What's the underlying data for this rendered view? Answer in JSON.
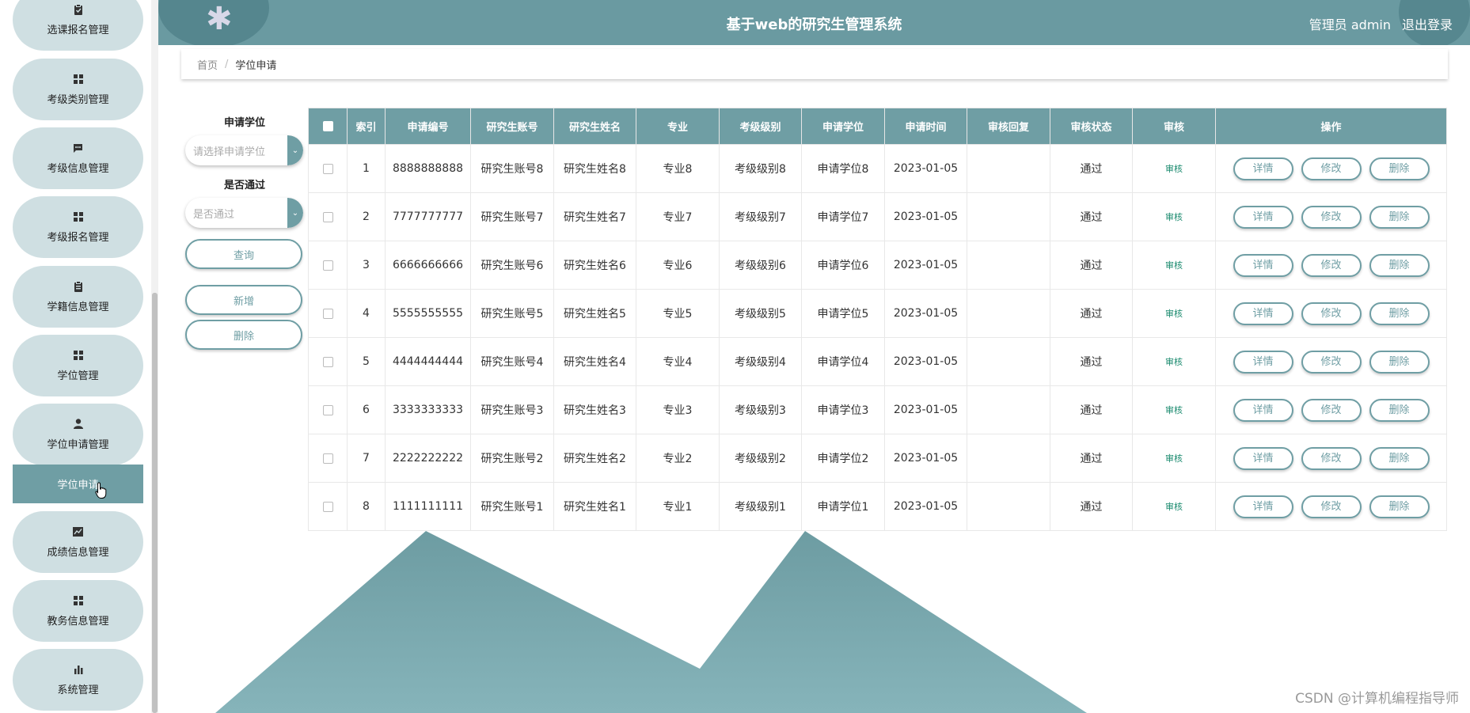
{
  "header": {
    "title": "基于web的研究生管理系统",
    "user_text": "管理员 admin",
    "logout_label": "退出登录"
  },
  "sidebar": {
    "items": [
      {
        "label": "选课报名管理",
        "icon": "clipboard-icon"
      },
      {
        "label": "考级类别管理",
        "icon": "grid-icon"
      },
      {
        "label": "考级信息管理",
        "icon": "chat-icon"
      },
      {
        "label": "考级报名管理",
        "icon": "grid-icon"
      },
      {
        "label": "学籍信息管理",
        "icon": "clipboard-icon"
      },
      {
        "label": "学位管理",
        "icon": "grid-icon"
      },
      {
        "label": "学位申请管理",
        "icon": "person-icon"
      },
      {
        "label": "成绩信息管理",
        "icon": "line-chart-icon"
      },
      {
        "label": "教务信息管理",
        "icon": "grid-icon"
      },
      {
        "label": "系统管理",
        "icon": "bar-chart-icon"
      }
    ],
    "active_sub": "学位申请"
  },
  "breadcrumb": {
    "home": "首页",
    "separator": "/",
    "current": "学位申请"
  },
  "search": {
    "degree_label": "申请学位",
    "degree_placeholder": "请选择申请学位",
    "passed_label": "是否通过",
    "passed_placeholder": "是否通过",
    "query_label": "查询",
    "add_label": "新增",
    "delete_label": "删除"
  },
  "table": {
    "columns": [
      "索引",
      "申请编号",
      "研究生账号",
      "研究生姓名",
      "专业",
      "考级级别",
      "申请学位",
      "申请时间",
      "审核回复",
      "审核状态",
      "审核",
      "操作"
    ],
    "audit_label": "审核",
    "op_labels": {
      "detail": "详情",
      "edit": "修改",
      "delete": "删除"
    },
    "rows": [
      {
        "index": "1",
        "app_no": "8888888888",
        "account": "研究生账号8",
        "name": "研究生姓名8",
        "major": "专业8",
        "level": "考级级别8",
        "degree": "申请学位8",
        "date": "2023-01-05",
        "reply": "",
        "status": "通过"
      },
      {
        "index": "2",
        "app_no": "7777777777",
        "account": "研究生账号7",
        "name": "研究生姓名7",
        "major": "专业7",
        "level": "考级级别7",
        "degree": "申请学位7",
        "date": "2023-01-05",
        "reply": "",
        "status": "通过"
      },
      {
        "index": "3",
        "app_no": "6666666666",
        "account": "研究生账号6",
        "name": "研究生姓名6",
        "major": "专业6",
        "level": "考级级别6",
        "degree": "申请学位6",
        "date": "2023-01-05",
        "reply": "",
        "status": "通过"
      },
      {
        "index": "4",
        "app_no": "5555555555",
        "account": "研究生账号5",
        "name": "研究生姓名5",
        "major": "专业5",
        "level": "考级级别5",
        "degree": "申请学位5",
        "date": "2023-01-05",
        "reply": "",
        "status": "通过"
      },
      {
        "index": "5",
        "app_no": "4444444444",
        "account": "研究生账号4",
        "name": "研究生姓名4",
        "major": "专业4",
        "level": "考级级别4",
        "degree": "申请学位4",
        "date": "2023-01-05",
        "reply": "",
        "status": "通过"
      },
      {
        "index": "6",
        "app_no": "3333333333",
        "account": "研究生账号3",
        "name": "研究生姓名3",
        "major": "专业3",
        "level": "考级级别3",
        "degree": "申请学位3",
        "date": "2023-01-05",
        "reply": "",
        "status": "通过"
      },
      {
        "index": "7",
        "app_no": "2222222222",
        "account": "研究生账号2",
        "name": "研究生姓名2",
        "major": "专业2",
        "level": "考级级别2",
        "degree": "申请学位2",
        "date": "2023-01-05",
        "reply": "",
        "status": "通过"
      },
      {
        "index": "8",
        "app_no": "1111111111",
        "account": "研究生账号1",
        "name": "研究生姓名1",
        "major": "专业1",
        "level": "考级级别1",
        "degree": "申请学位1",
        "date": "2023-01-05",
        "reply": "",
        "status": "通过"
      }
    ]
  },
  "watermark": "CSDN @计算机编程指导师",
  "colors": {
    "primary": "#6f9ea4",
    "header": "#6a9aa1",
    "menu_pill": "#cfdfe2",
    "audit_link": "#1a8a6e"
  }
}
